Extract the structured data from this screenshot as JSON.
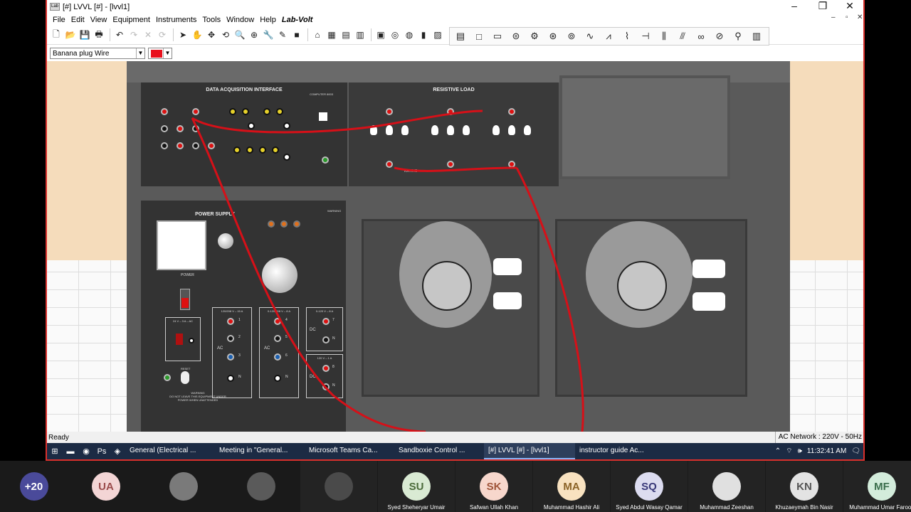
{
  "window": {
    "title": "[#] LVVL [#] - [lvvl1]",
    "min": "–",
    "max": "❐",
    "close": "✕",
    "mdi_min": "–",
    "mdi_restore": "▫",
    "mdi_close": "✕"
  },
  "menu": [
    "File",
    "Edit",
    "View",
    "Equipment",
    "Instruments",
    "Tools",
    "Window",
    "Help"
  ],
  "brand": "Lab-Volt",
  "toolbar": {
    "icons": [
      "new-icon",
      "open-icon",
      "save-icon",
      "print-icon",
      "undo-icon",
      "redo-icon",
      "delete-icon",
      "rotate-icon",
      "pointer-icon",
      "hand-icon",
      "move-icon",
      "rotate-view-icon",
      "zoom-icon",
      "zoom-in-icon",
      "probe-icon",
      "pen-icon",
      "color-box-icon",
      "home-icon",
      "meters-icon",
      "table-icon",
      "grid-icon",
      "oscilloscope-icon",
      "phasor-icon",
      "harmonic-icon",
      "chart-icon",
      "scope-icon"
    ],
    "glyphs": [
      "🗋",
      "📂",
      "💾",
      "🖶",
      "↶",
      "↷",
      "✕",
      "⟳",
      "➤",
      "✋",
      "✥",
      "⟲",
      "🔍",
      "⊕",
      "🔧",
      "✎",
      "■",
      "⌂",
      "▦",
      "▤",
      "▥",
      "▣",
      "◎",
      "◍",
      "▮",
      "▨"
    ]
  },
  "toolbar2": {
    "icons": [
      "panel-icon",
      "square-icon",
      "rect-icon",
      "lamp-icon",
      "gear-icon",
      "motor-icon",
      "generator-icon",
      "source-icon",
      "resistor-icon",
      "inductor-icon",
      "capacitor-icon",
      "transformer-icon",
      "transformer2-icon",
      "coils-icon",
      "meter-icon",
      "bulb-icon",
      "module-icon"
    ],
    "glyphs": [
      "▤",
      "□",
      "▭",
      "⊜",
      "⚙",
      "⊛",
      "⊚",
      "∿",
      "⩘",
      "⌇",
      "⊣",
      "⫼",
      "⫻",
      "∞",
      "⊘",
      "⚲",
      "▥"
    ]
  },
  "options": {
    "wire_type": "Banana plug Wire",
    "wire_color": "#e8101c"
  },
  "equipment": {
    "daq_title": "DATA ACQUISITION INTERFACE",
    "daq_code": "COMPUTER 8003",
    "resistive_title": "RESISTIVE LOAD",
    "rating": "RATING",
    "power_title": "POWER SUPPLY",
    "warning": "WARNING",
    "power_label": "POWER",
    "reset": "RESET",
    "ac_range1": "120/208 V – 15 A",
    "ac_range2": "0-120/208 V – 8 A",
    "dc_range1": "0-120 V – 8 A",
    "dc_range2": "120 V – 1 A",
    "ac": "AC",
    "dc": "DC",
    "small_range": "24 V – 3 A – AC",
    "n": "N",
    "numbers": [
      "1",
      "2",
      "3",
      "4",
      "5",
      "6",
      "7",
      "8"
    ],
    "warning_text": "DO NOT LEAVE THIS EQUIPMENT UNDER POWER WHEN UNATTENDED"
  },
  "status": {
    "left": "Ready",
    "right": "AC Network : 220V - 50Hz"
  },
  "taskbar": {
    "apps": [
      {
        "label": "General (Electrical ...",
        "active": false
      },
      {
        "label": "Meeting in \"General...",
        "active": false
      },
      {
        "label": "Microsoft Teams Ca...",
        "active": false
      },
      {
        "label": "Sandboxie Control ...",
        "active": false
      },
      {
        "label": "[#] LVVL [#] - [lvvl1]",
        "active": true
      },
      {
        "label": "instructor guide Ac...",
        "active": false
      }
    ],
    "time": "11:32:41 AM"
  },
  "participants": {
    "overflow": "+20",
    "tiles": [
      {
        "initials": "UA",
        "name": "",
        "color": "#f3d5d5",
        "fg": "#9a4b4b",
        "photo": false
      },
      {
        "initials": "",
        "name": "",
        "color": "#7a7a7a",
        "fg": "#fff",
        "photo": true
      },
      {
        "initials": "",
        "name": "",
        "color": "#5a5a5a",
        "fg": "#fff",
        "photo": true
      },
      {
        "initials": "",
        "name": "",
        "color": "#4a4a4a",
        "fg": "#fff",
        "photo": true
      },
      {
        "initials": "SU",
        "name": "Syed Sheheryar Umair",
        "color": "#d9ead3",
        "fg": "#4b6b3a",
        "photo": false
      },
      {
        "initials": "SK",
        "name": "Safwan Ullah Khan",
        "color": "#f7d7cc",
        "fg": "#a0553a",
        "photo": false
      },
      {
        "initials": "MA",
        "name": "Muhammad Hashir Ali",
        "color": "#f8e2c0",
        "fg": "#8a6226",
        "photo": false
      },
      {
        "initials": "SQ",
        "name": "Syed Abdul Wasay Qamar",
        "color": "#dcdcf0",
        "fg": "#3a3a7a",
        "photo": false
      },
      {
        "initials": "",
        "name": "Muhammad Zeeshan",
        "color": "#e0e0e0",
        "fg": "#555",
        "photo": true
      },
      {
        "initials": "KN",
        "name": "Khuzaeymah Bin Nasir",
        "color": "#e3e3e3",
        "fg": "#555",
        "photo": false
      },
      {
        "initials": "MF",
        "name": "Muhammad Umar Farooq",
        "color": "#d3ecdb",
        "fg": "#3b6e4c",
        "photo": false
      }
    ]
  }
}
